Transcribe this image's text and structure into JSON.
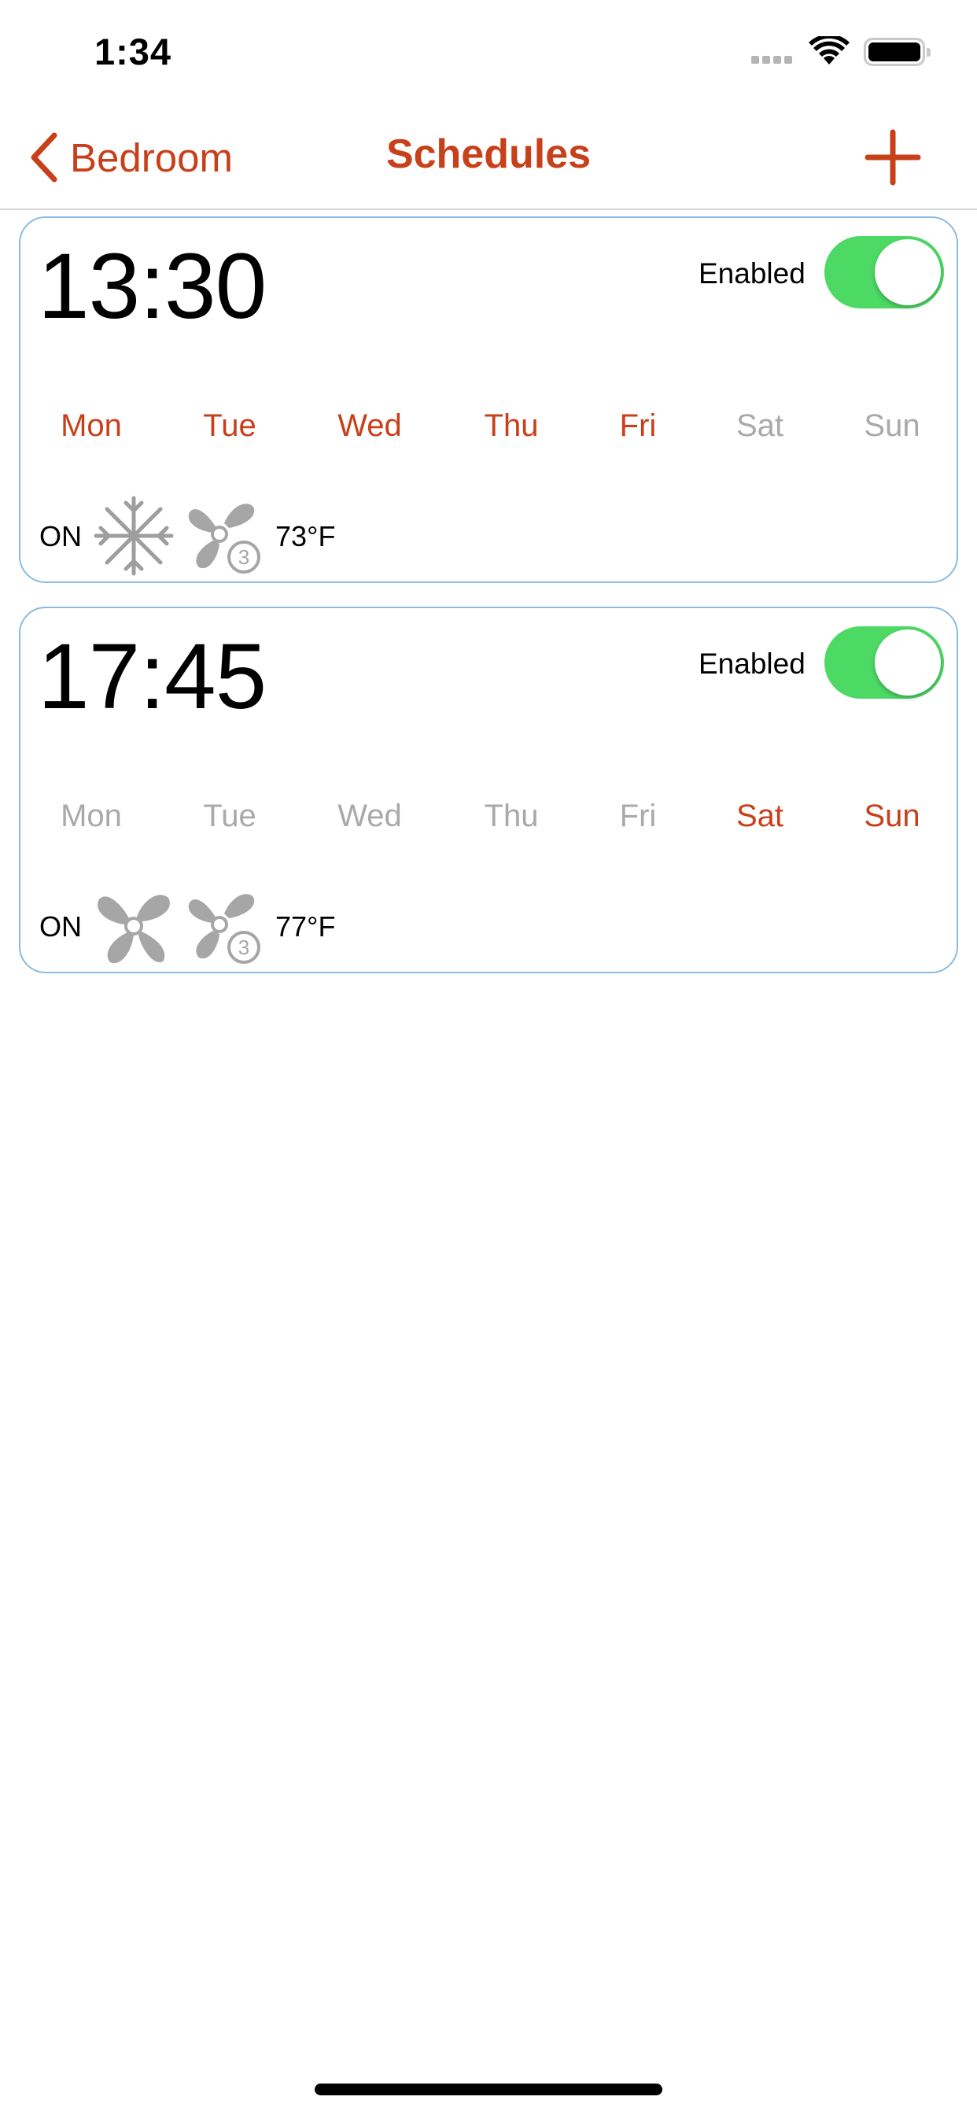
{
  "status_bar": {
    "time": "1:34"
  },
  "nav": {
    "back_label": "Bedroom",
    "title": "Schedules",
    "add_icon": "plus-icon"
  },
  "colors": {
    "accent": "#c8401a",
    "toggle_on": "#4cd964",
    "inactive": "#a9a9a9",
    "card_border": "#8bbbe0"
  },
  "schedules": [
    {
      "time": "13:30",
      "enabled_label": "Enabled",
      "enabled": true,
      "days": [
        {
          "label": "Mon",
          "active": true
        },
        {
          "label": "Tue",
          "active": true
        },
        {
          "label": "Wed",
          "active": true
        },
        {
          "label": "Thu",
          "active": true
        },
        {
          "label": "Fri",
          "active": true
        },
        {
          "label": "Sat",
          "active": false
        },
        {
          "label": "Sun",
          "active": false
        }
      ],
      "power": "ON",
      "mode_icon": "snowflake-icon",
      "fan_icon": "fan-speed-3-icon",
      "fan_level": "3",
      "temperature": "73°F"
    },
    {
      "time": "17:45",
      "enabled_label": "Enabled",
      "enabled": true,
      "days": [
        {
          "label": "Mon",
          "active": false
        },
        {
          "label": "Tue",
          "active": false
        },
        {
          "label": "Wed",
          "active": false
        },
        {
          "label": "Thu",
          "active": false
        },
        {
          "label": "Fri",
          "active": false
        },
        {
          "label": "Sat",
          "active": true
        },
        {
          "label": "Sun",
          "active": true
        }
      ],
      "power": "ON",
      "mode_icon": "fan-mode-icon",
      "fan_icon": "fan-speed-3-icon",
      "fan_level": "3",
      "temperature": "77°F"
    }
  ]
}
